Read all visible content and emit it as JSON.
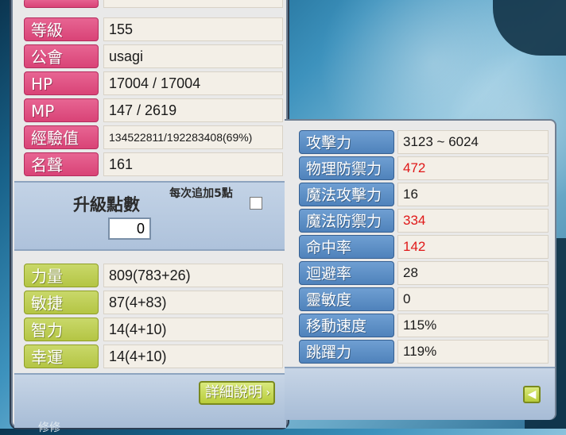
{
  "character": {
    "rows": [
      {
        "label": "等級",
        "value": "155"
      },
      {
        "label": "公會",
        "value": "usagi"
      },
      {
        "label": "HP",
        "value": "17004 / 17004"
      },
      {
        "label": "MP",
        "value": "147 / 2619"
      },
      {
        "label": "經驗值",
        "value": "134522811/192283408(69%)"
      },
      {
        "label": "名聲",
        "value": "161"
      }
    ],
    "ability_points": {
      "title": "升級點數",
      "value": "0",
      "auto_label": "每次追加5點",
      "auto_checked": false
    },
    "attributes": [
      {
        "label": "力量",
        "value": "809(783+26)"
      },
      {
        "label": "敏捷",
        "value": "87(4+83)"
      },
      {
        "label": "智力",
        "value": "14(4+10)"
      },
      {
        "label": "幸運",
        "value": "14(4+10)"
      }
    ],
    "detail_button": "詳細說明"
  },
  "details": {
    "rows": [
      {
        "label": "攻擊力",
        "value": "3123 ~ 6024",
        "highlight": false
      },
      {
        "label": "物理防禦力",
        "value": "472",
        "highlight": true
      },
      {
        "label": "魔法攻擊力",
        "value": "16",
        "highlight": false
      },
      {
        "label": "魔法防禦力",
        "value": "334",
        "highlight": true
      },
      {
        "label": "命中率",
        "value": "142",
        "highlight": true
      },
      {
        "label": "迴避率",
        "value": "28",
        "highlight": false
      },
      {
        "label": "靈敏度",
        "value": "0",
        "highlight": false
      },
      {
        "label": "移動速度",
        "value": "115%",
        "highlight": false
      },
      {
        "label": "跳躍力",
        "value": "119%",
        "highlight": false
      }
    ],
    "back_button_icon": "arrow-left-icon"
  },
  "background_text": "修修",
  "colors": {
    "label_pink": "#d94377",
    "label_lime": "#b4c544",
    "label_blue": "#4f82bb",
    "highlight_red": "#e01818"
  }
}
